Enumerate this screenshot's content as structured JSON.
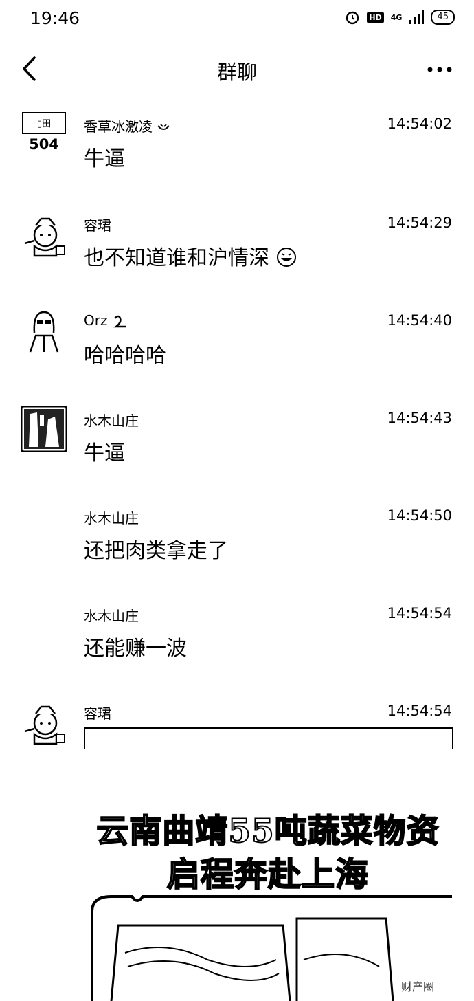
{
  "status": {
    "time": "19:46",
    "hd": "HD",
    "network": "4G",
    "battery": "45"
  },
  "nav": {
    "title": "群聊"
  },
  "messages": [
    {
      "sender": "香草冰激凌",
      "time": "14:54:02",
      "text": "牛逼",
      "avatar": "card-504-avatar",
      "avatar_text": "504"
    },
    {
      "sender": "容珺",
      "time": "14:54:29",
      "text": "也不知道谁和沪情深",
      "avatar": "cartoon-cat-avatar"
    },
    {
      "sender": "Orz",
      "time": "14:54:40",
      "text": "哈哈哈哈",
      "avatar": "sunglasses-girl-avatar"
    },
    {
      "sender": "水木山庄",
      "time": "14:54:43",
      "text": "牛逼",
      "avatar": "photo-avatar"
    },
    {
      "sender": "水木山庄",
      "time": "14:54:50",
      "text": "还把肉类拿走了"
    },
    {
      "sender": "水木山庄",
      "time": "14:54:54",
      "text": "还能赚一波"
    },
    {
      "sender": "容珺",
      "time": "14:54:54",
      "avatar": "cartoon-cat-avatar"
    }
  ],
  "video": {
    "title_line1": "云南曲靖55吨蔬菜物资",
    "title_line2": "启程奔赴上海"
  },
  "watermark": "财产圈"
}
